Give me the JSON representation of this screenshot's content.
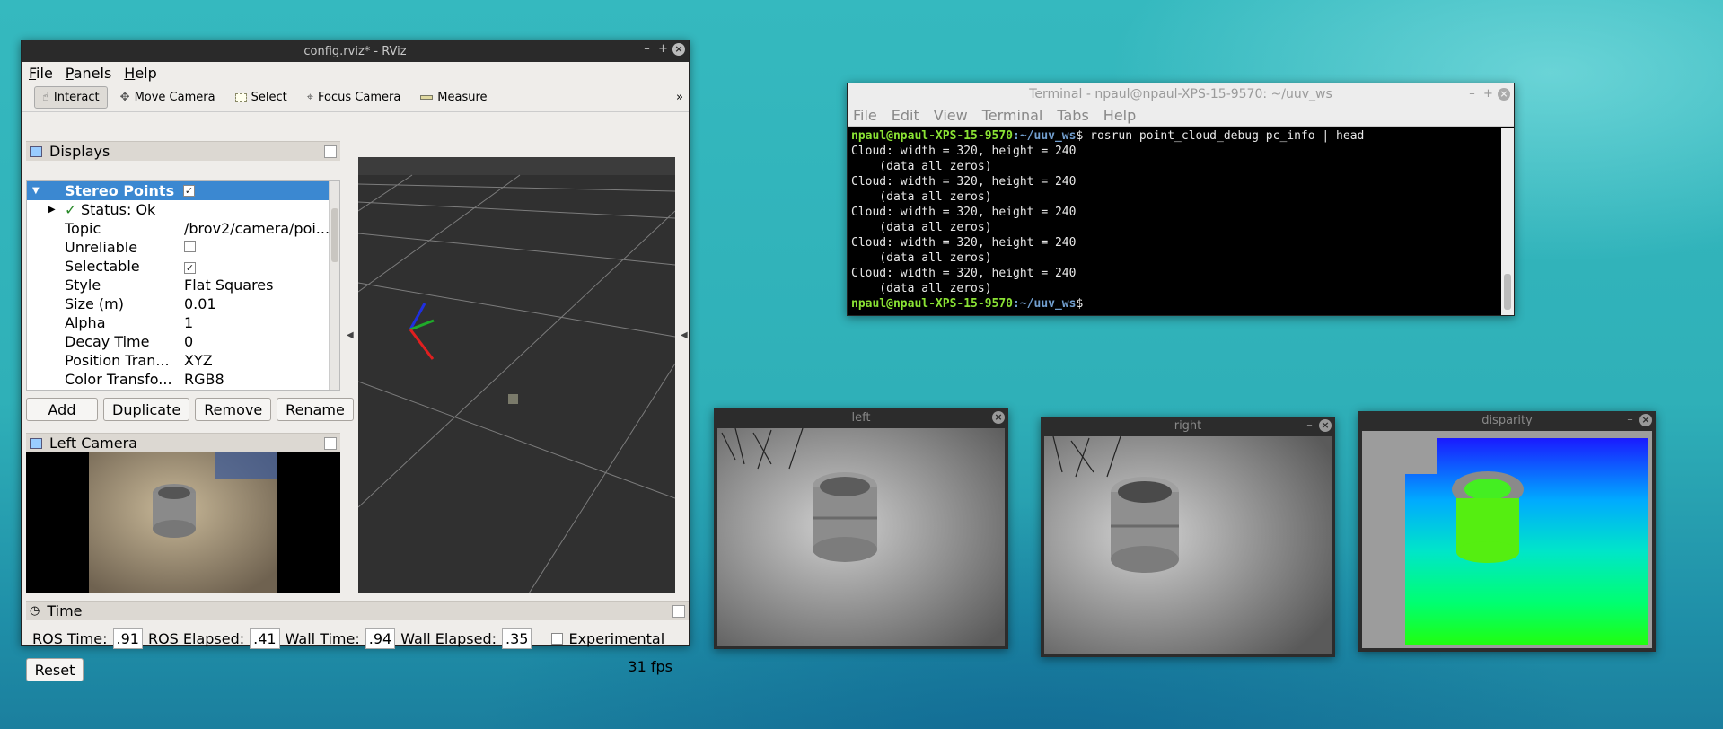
{
  "rviz": {
    "title": "config.rviz* - RViz",
    "menu": [
      "File",
      "Panels",
      "Help"
    ],
    "toolbar": [
      {
        "label": "Interact",
        "icon": "hand-icon"
      },
      {
        "label": "Move Camera",
        "icon": "move-camera-icon"
      },
      {
        "label": "Select",
        "icon": "select-icon"
      },
      {
        "label": "Focus Camera",
        "icon": "focus-camera-icon"
      },
      {
        "label": "Measure",
        "icon": "measure-icon"
      }
    ],
    "toolbar_more": "»",
    "displays_title": "Displays",
    "stereo_points": "Stereo Points",
    "status": "Status: Ok",
    "props": [
      {
        "key": "Topic",
        "value": "/brov2/camera/poi..."
      },
      {
        "key": "Unreliable",
        "value": ""
      },
      {
        "key": "Selectable",
        "value": "✓"
      },
      {
        "key": "Style",
        "value": "Flat Squares"
      },
      {
        "key": "Size (m)",
        "value": "0.01"
      },
      {
        "key": "Alpha",
        "value": "1"
      },
      {
        "key": "Decay Time",
        "value": "0"
      },
      {
        "key": "Position Tran...",
        "value": "XYZ"
      },
      {
        "key": "Color Transfo...",
        "value": "RGB8"
      }
    ],
    "buttons": {
      "add": "Add",
      "duplicate": "Duplicate",
      "remove": "Remove",
      "rename": "Rename"
    },
    "left_camera_title": "Left Camera",
    "time": {
      "title": "Time",
      "ros_time_label": "ROS Time:",
      "ros_time": ".91",
      "ros_elapsed_label": "ROS Elapsed:",
      "ros_elapsed": ".41",
      "wall_time_label": "Wall Time:",
      "wall_time": ".94",
      "wall_elapsed_label": "Wall Elapsed:",
      "wall_elapsed": ".35",
      "experimental": "Experimental",
      "reset": "Reset",
      "fps": "31 fps"
    }
  },
  "terminal": {
    "title": "Terminal - npaul@npaul-XPS-15-9570: ~/uuv_ws",
    "menu": [
      "File",
      "Edit",
      "View",
      "Terminal",
      "Tabs",
      "Help"
    ],
    "prompt_user": "npaul@npaul-XPS-15-9570",
    "prompt_path": ":~/uuv_ws",
    "prompt_end": "$",
    "command": " rosrun point_cloud_debug pc_info | head",
    "line_a": "Cloud: width = 320, height = 240",
    "line_b": "    (data all zeros)"
  },
  "windows": {
    "left": "left",
    "right": "right",
    "disparity": "disparity"
  }
}
